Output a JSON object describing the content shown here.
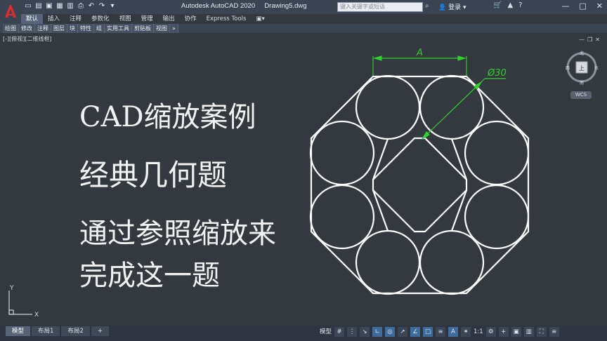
{
  "titlebar": {
    "app_name": "Autodesk AutoCAD 2020",
    "document": "Drawing5.dwg",
    "search_placeholder": "键入关键字或短语",
    "login": "登录"
  },
  "ribbon_tabs": [
    "默认",
    "插入",
    "注释",
    "参数化",
    "视图",
    "管理",
    "输出",
    "协作",
    "Express Tools"
  ],
  "ribbon_groups": [
    "绘图",
    "修改",
    "注释",
    "图层",
    "块",
    "特性",
    "组",
    "实用工具",
    "剪贴板",
    "视图"
  ],
  "viewport_label": "[-][俯视][二维线框]",
  "overlay_text": {
    "line1": "CAD缩放案例",
    "line2": "经典几何题",
    "line3": "通过参照缩放来",
    "line4": "完成这一题"
  },
  "drawing": {
    "dim_a_label": "A",
    "dim_dia_label": "Ø30"
  },
  "viewcube": {
    "north": "北",
    "south": "南",
    "east": "东",
    "west": "西",
    "face": "上",
    "wcs": "WCS"
  },
  "ucs": {
    "x": "X",
    "y": "Y"
  },
  "layout_tabs": [
    "模型",
    "布局1",
    "布局2"
  ],
  "status": {
    "model": "模型",
    "scale": "1:1"
  }
}
